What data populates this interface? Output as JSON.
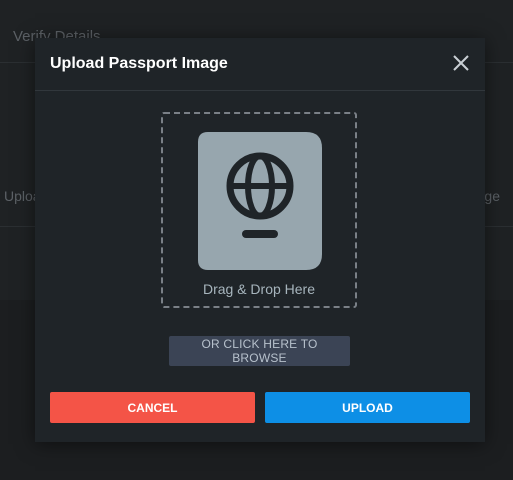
{
  "background": {
    "title": "Verify Details",
    "row_left_text": "Upload",
    "row_right_text": "Passport Image"
  },
  "modal": {
    "title": "Upload Passport Image",
    "close_icon": "close-icon",
    "dropzone": {
      "icon": "passport-icon",
      "label": "Drag & Drop Here"
    },
    "browse_label": "OR CLICK HERE TO BROWSE",
    "cancel_label": "CANCEL",
    "upload_label": "UPLOAD"
  },
  "colors": {
    "cancel": "#f45447",
    "upload": "#0d8fe6",
    "browse": "#3b4455",
    "modal_bg": "#1f2428"
  }
}
